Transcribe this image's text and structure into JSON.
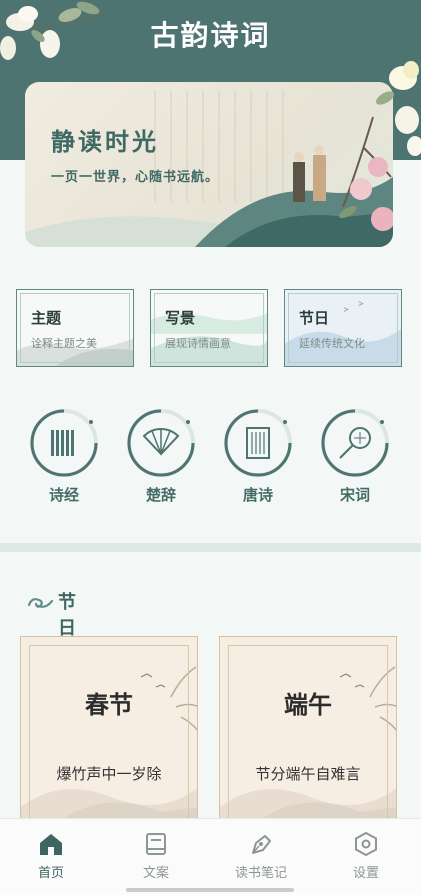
{
  "header": {
    "title": "古韵诗词"
  },
  "banner": {
    "title": "静读时光",
    "subtitle": "一页一世界，心随书远航。"
  },
  "categories": [
    {
      "title": "主题",
      "desc": "诠释主题之美"
    },
    {
      "title": "写景",
      "desc": "展现诗情画意"
    },
    {
      "title": "节日",
      "desc": "延续传统文化"
    }
  ],
  "classics": [
    {
      "label": "诗经",
      "icon": "bamboo-slips-icon"
    },
    {
      "label": "楚辞",
      "icon": "folding-fan-icon"
    },
    {
      "label": "唐诗",
      "icon": "book-scroll-icon"
    },
    {
      "label": "宋词",
      "icon": "round-fan-icon"
    }
  ],
  "section": {
    "title": "节日"
  },
  "festivals": [
    {
      "name": "春节",
      "line": "爆竹声中一岁除"
    },
    {
      "name": "端午",
      "line": "节分端午自难言"
    }
  ],
  "tabs": [
    {
      "label": "首页",
      "icon": "home-icon",
      "active": true
    },
    {
      "label": "文案",
      "icon": "book-icon",
      "active": false
    },
    {
      "label": "读书笔记",
      "icon": "pen-icon",
      "active": false
    },
    {
      "label": "设置",
      "icon": "settings-icon",
      "active": false
    }
  ],
  "colors": {
    "accent": "#4d7470",
    "background": "#f3f8f6",
    "festival_card": "#f7eee3"
  }
}
